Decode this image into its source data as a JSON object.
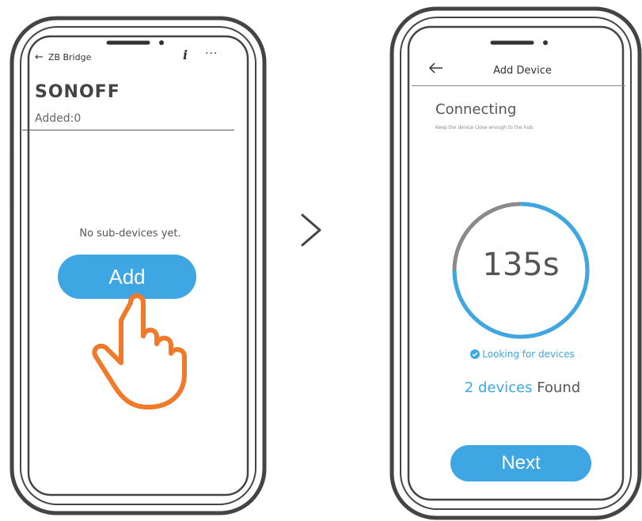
{
  "left_screen": {
    "back_label": "ZB Bridge",
    "info_label": "i",
    "more_label": "···",
    "logo_text": "SONOFF",
    "added_label": "Added:0",
    "empty_message": "No sub-devices  yet.",
    "add_button_label": "Add"
  },
  "right_screen": {
    "title": "Add Device",
    "heading": "Connecting",
    "subtext": "Keep the device close enough to the hub.",
    "countdown": "135s",
    "status_text": "Looking for devices",
    "found_count": "2 devices",
    "found_label": " Found",
    "next_button_label": "Next"
  },
  "colors": {
    "accent": "#3da6e3",
    "hand": "#f07a2a",
    "outline": "#555555"
  },
  "icons": {
    "left_back": "arrow-left-icon",
    "info": "info-icon",
    "more": "more-icon",
    "step": "chevron-right-icon",
    "right_back": "arrow-left-icon",
    "check": "check-circle-icon",
    "hand": "pointing-hand-icon"
  }
}
